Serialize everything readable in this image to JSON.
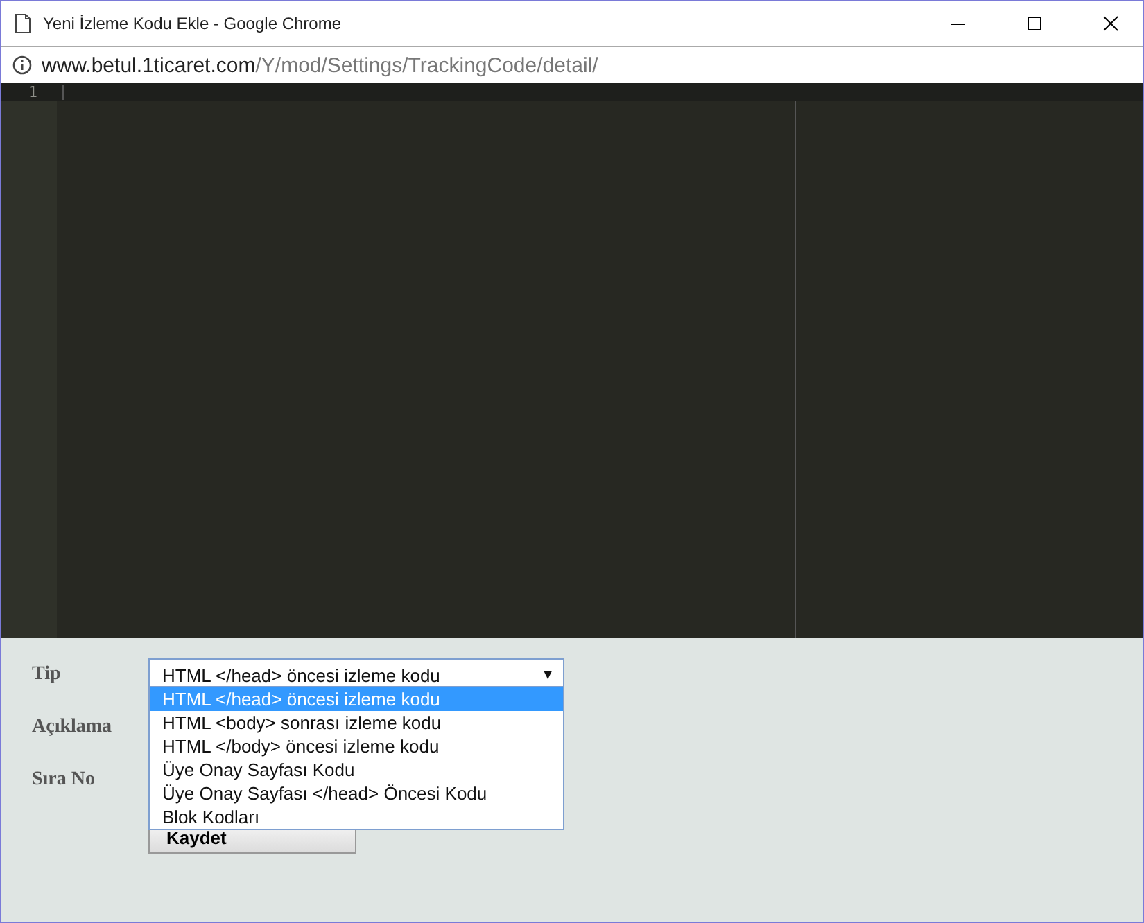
{
  "window": {
    "title": "Yeni İzleme Kodu Ekle - Google Chrome"
  },
  "address_bar": {
    "host": "www.betul.1ticaret.com",
    "path": "/Y/mod/Settings/TrackingCode/detail/"
  },
  "editor": {
    "line_numbers": [
      "1"
    ]
  },
  "form": {
    "labels": [
      "Tip",
      "Açıklama",
      "Sıra No"
    ],
    "tip_select": {
      "value": "HTML </head> öncesi izleme kodu",
      "expanded": true,
      "arrow": "▼",
      "options": [
        {
          "label": "HTML </head> öncesi izleme kodu",
          "selected": true
        },
        {
          "label": "HTML <body> sonrası izleme kodu",
          "selected": false
        },
        {
          "label": "HTML </body> öncesi izleme kodu",
          "selected": false
        },
        {
          "label": "Üye Onay Sayfası Kodu",
          "selected": false
        },
        {
          "label": "Üye Onay Sayfası </head> Öncesi Kodu",
          "selected": false
        },
        {
          "label": "Blok Kodları",
          "selected": false
        }
      ]
    },
    "save_button": "Kaydet"
  }
}
